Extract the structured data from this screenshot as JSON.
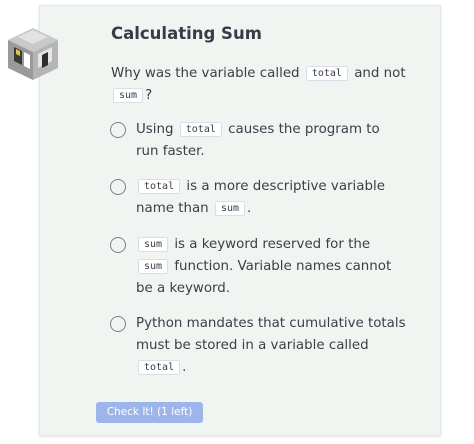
{
  "title": "Calculating Sum",
  "question": {
    "prefix": "Why was the variable called",
    "code1": "total",
    "mid": "and not",
    "code2": "sum",
    "suffix": "?"
  },
  "options": [
    {
      "pre": "Using",
      "code": "total",
      "post": "causes the program to run faster."
    },
    {
      "code": "total",
      "mid": "is a more descriptive variable name than",
      "code2": "sum",
      "post": "."
    },
    {
      "code": "sum",
      "mid": "is a keyword reserved for the",
      "code2": "sum",
      "post": "function. Variable names cannot be a keyword."
    },
    {
      "pre": "Python mandates that cumulative totals must be stored in a variable called",
      "code": "total",
      "post": "."
    }
  ],
  "check_button": "Check It! (1 left)",
  "icons": {
    "logo": "codio-cube-logo-icon",
    "radio": "radio-unselected-icon"
  },
  "colors": {
    "card_bg": "#f1f5f1",
    "button_bg": "#9db5ea",
    "text": "#3d3d4a"
  }
}
